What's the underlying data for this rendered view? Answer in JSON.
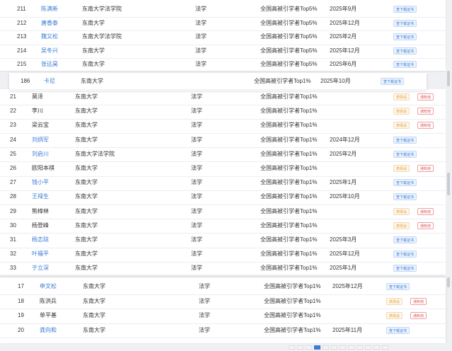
{
  "buttons": {
    "cert": "查下载证书",
    "tag": "表扬设",
    "notify": "通知他"
  },
  "panel1": [
    {
      "num": "211",
      "name": "陈满新",
      "school": "东南大学法学院",
      "major": "法学",
      "level": "全国高被引学者Top5%",
      "date": "2025年9月",
      "actions": [
        "cert"
      ]
    },
    {
      "num": "212",
      "name": "唐香泰",
      "school": "东南大学",
      "major": "法学",
      "level": "全国高被引学者Top5%",
      "date": "2025年12月",
      "actions": [
        "cert"
      ]
    },
    {
      "num": "213",
      "name": "魏又松",
      "school": "东南大学法学院",
      "major": "法学",
      "level": "全国高被引学者Top5%",
      "date": "2025年2月",
      "actions": [
        "cert"
      ]
    },
    {
      "num": "214",
      "name": "吴冬兴",
      "school": "东南大学",
      "major": "法学",
      "level": "全国高被引学者Top5%",
      "date": "2025年12月",
      "actions": [
        "cert"
      ]
    },
    {
      "num": "215",
      "name": "张远昊",
      "school": "东南大学",
      "major": "法学",
      "level": "全国高被引学者Top5%",
      "date": "2025年6月",
      "actions": [
        "cert"
      ]
    }
  ],
  "panel2": [
    {
      "num": "186",
      "name": "卡尼",
      "school": "东南大学",
      "major": "",
      "level": "全国高被引学者Top1%",
      "date": "2025年10月",
      "actions": [
        "cert"
      ]
    }
  ],
  "panel3": [
    {
      "num": "21",
      "name": "莫泽",
      "school": "东南大学",
      "major": "法学",
      "level": "全国高被引学者Top1%",
      "date": "",
      "actions": [
        "tag",
        "notify"
      ]
    },
    {
      "num": "22",
      "name": "李川",
      "school": "东南大学",
      "major": "法学",
      "level": "全国高被引学者Top1%",
      "date": "",
      "actions": [
        "tag",
        "notify"
      ]
    },
    {
      "num": "23",
      "name": "梁云宝",
      "school": "东南大学",
      "major": "法学",
      "level": "全国高被引学者Top1%",
      "date": "",
      "actions": [
        "tag",
        "notify"
      ]
    },
    {
      "num": "24",
      "name": "刘炳军",
      "school": "东南大学",
      "major": "法学",
      "level": "全国高被引学者Top1%",
      "date": "2024年12月",
      "actions": [
        "cert"
      ]
    },
    {
      "num": "25",
      "name": "刘启川",
      "school": "东南大学法学院",
      "major": "法学",
      "level": "全国高被引学者Top1%",
      "date": "2025年2月",
      "actions": [
        "cert"
      ]
    },
    {
      "num": "26",
      "name": "欧阳本祺",
      "school": "东南大学",
      "major": "法学",
      "level": "全国高被引学者Top1%",
      "date": "",
      "actions": [
        "tag",
        "notify"
      ]
    },
    {
      "num": "27",
      "name": "钱小平",
      "school": "东南大学",
      "major": "法学",
      "level": "全国高被引学者Top1%",
      "date": "2025年1月",
      "actions": [
        "cert"
      ]
    },
    {
      "num": "28",
      "name": "王禄生",
      "school": "东南大学",
      "major": "法学",
      "level": "全国高被引学者Top1%",
      "date": "2025年10月",
      "actions": [
        "cert"
      ]
    },
    {
      "num": "29",
      "name": "熊樟林",
      "school": "东南大学",
      "major": "法学",
      "level": "全国高被引学者Top1%",
      "date": "",
      "actions": [
        "tag",
        "notify"
      ]
    },
    {
      "num": "30",
      "name": "杨登峰",
      "school": "东南大学",
      "major": "法学",
      "level": "全国高被引学者Top1%",
      "date": "",
      "actions": [
        "tag",
        "notify"
      ]
    },
    {
      "num": "31",
      "name": "杨志琼",
      "school": "东南大学",
      "major": "法学",
      "level": "全国高被引学者Top1%",
      "date": "2025年3月",
      "actions": [
        "cert"
      ]
    },
    {
      "num": "32",
      "name": "叶福平",
      "school": "东南大学",
      "major": "法学",
      "level": "全国高被引学者Top1%",
      "date": "2025年12月",
      "actions": [
        "cert"
      ]
    },
    {
      "num": "33",
      "name": "于立深",
      "school": "东南大学",
      "major": "法学",
      "level": "全国高被引学者Top1%",
      "date": "2025年1月",
      "actions": [
        "cert"
      ]
    }
  ],
  "panel4": [
    {
      "num": "17",
      "name": "申文松",
      "school": "东南大学",
      "major": "法学",
      "level": "全国高被引学者Top1%",
      "date": "2025年12月",
      "actions": [
        "cert"
      ]
    },
    {
      "num": "18",
      "name": "陈洪兵",
      "school": "东南大学",
      "major": "法学",
      "level": "全国高被引学者Top1%",
      "date": "",
      "actions": [
        "tag",
        "notify"
      ]
    },
    {
      "num": "19",
      "name": "单平基",
      "school": "东南大学",
      "major": "法学",
      "level": "全国高被引学者Top1%",
      "date": "",
      "actions": [
        "tag",
        "notify"
      ]
    },
    {
      "num": "20",
      "name": "龚向和",
      "school": "东南大学",
      "major": "法学",
      "level": "全国高被引学者Top1%",
      "date": "2025年11月",
      "actions": [
        "cert"
      ]
    }
  ]
}
